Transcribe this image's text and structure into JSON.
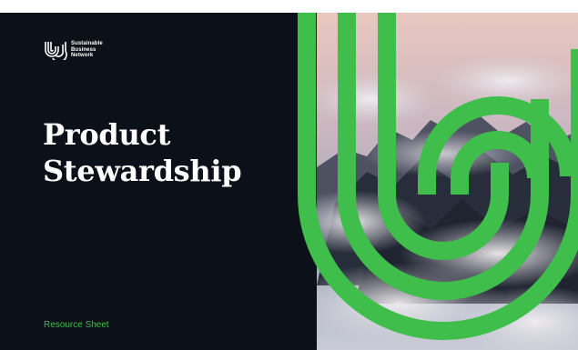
{
  "logo": {
    "lines": [
      "Sustainable",
      "Business",
      "Network"
    ]
  },
  "title": {
    "line1": "Product",
    "line2": "Stewardship"
  },
  "subtitle": "Resource Sheet",
  "colors": {
    "background_dark": "#0b1019",
    "accent_green": "#3fbe4b",
    "title_text": "#ffffff"
  },
  "image": {
    "subject": "mountain peaks above clouds at dusk"
  }
}
